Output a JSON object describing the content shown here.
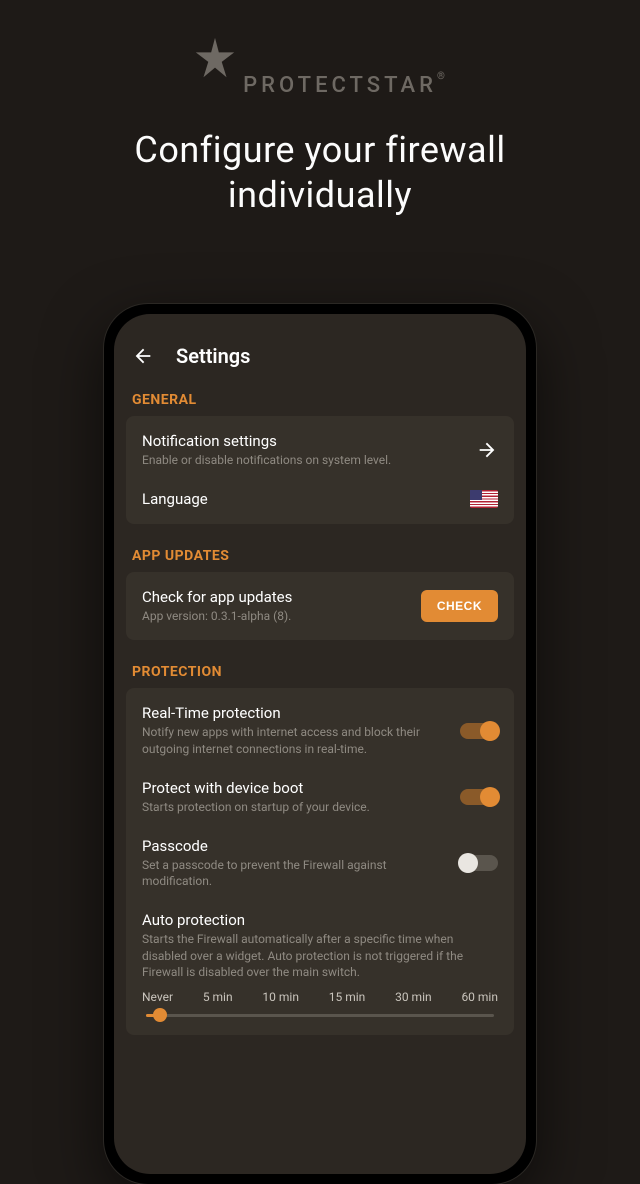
{
  "brand": {
    "name": "PROTECTSTAR"
  },
  "hero": {
    "line1": "Configure your firewall",
    "line2": "individually"
  },
  "appbar": {
    "title": "Settings"
  },
  "sections": {
    "general": {
      "label": "GENERAL",
      "notif": {
        "title": "Notification settings",
        "sub": "Enable or disable notifications on system level."
      },
      "lang": {
        "title": "Language"
      }
    },
    "updates": {
      "label": "APP UPDATES",
      "check": {
        "title": "Check for app updates",
        "sub": "App version: 0.3.1-alpha (8).",
        "btn": "CHECK"
      }
    },
    "protection": {
      "label": "PROTECTION",
      "realtime": {
        "title": "Real-Time protection",
        "sub": "Notify new apps with internet access and block their outgoing internet connections in real-time.",
        "on": true
      },
      "boot": {
        "title": "Protect with device boot",
        "sub": "Starts protection on startup of your device.",
        "on": true
      },
      "passcode": {
        "title": "Passcode",
        "sub": "Set a passcode to prevent the Firewall against modification.",
        "on": false
      },
      "auto": {
        "title": "Auto protection",
        "sub": "Starts the Firewall automatically after a specific time when disabled over a widget. Auto protection is not triggered if the Firewall is disabled over the main switch."
      },
      "slider": {
        "options": [
          "Never",
          "5 min",
          "10 min",
          "15 min",
          "30 min",
          "60 min"
        ],
        "selected": 0
      }
    }
  }
}
